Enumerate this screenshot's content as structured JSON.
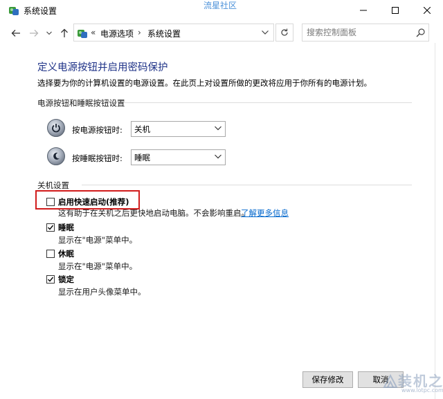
{
  "window": {
    "title": "系统设置",
    "watermark_top": "流星社区"
  },
  "address": {
    "overflow": "«",
    "crumbs": [
      "电源选项",
      "系统设置"
    ],
    "separator": "›"
  },
  "search": {
    "placeholder": "搜索控制面板"
  },
  "content": {
    "title": "定义电源按钮并启用密码保护",
    "description": "选择要为你的计算机设置的电源设置。在此页上对设置所做的更改将应用于你所有的电源计划。",
    "power_section": "电源按钮和睡眠按钮设置",
    "power_button_label": "按电源按钮时:",
    "power_button_value": "关机",
    "sleep_button_label": "按睡眠按钮时:",
    "sleep_button_value": "睡眠",
    "shutdown_section": "关机设置",
    "options": [
      {
        "label": "启用快速启动(推荐)",
        "desc": "这有助于在关机之后更快地启动电脑。不会影响重启。",
        "checked": false
      },
      {
        "label": "睡眠",
        "desc": "显示在\"电源\"菜单中。",
        "checked": true
      },
      {
        "label": "休眠",
        "desc": "显示在\"电源\"菜单中。",
        "checked": false
      },
      {
        "label": "锁定",
        "desc": "显示在用户头像菜单中。",
        "checked": true
      }
    ],
    "learn_more": "了解更多信息"
  },
  "buttons": {
    "save": "保存修改",
    "cancel": "取消"
  },
  "watermark_bottom": {
    "text": "装机之家",
    "url": "www.lotpc.com"
  },
  "colors": {
    "title_blue": "#1e3287",
    "link": "#0066cc",
    "highlight": "#d11b1b"
  }
}
